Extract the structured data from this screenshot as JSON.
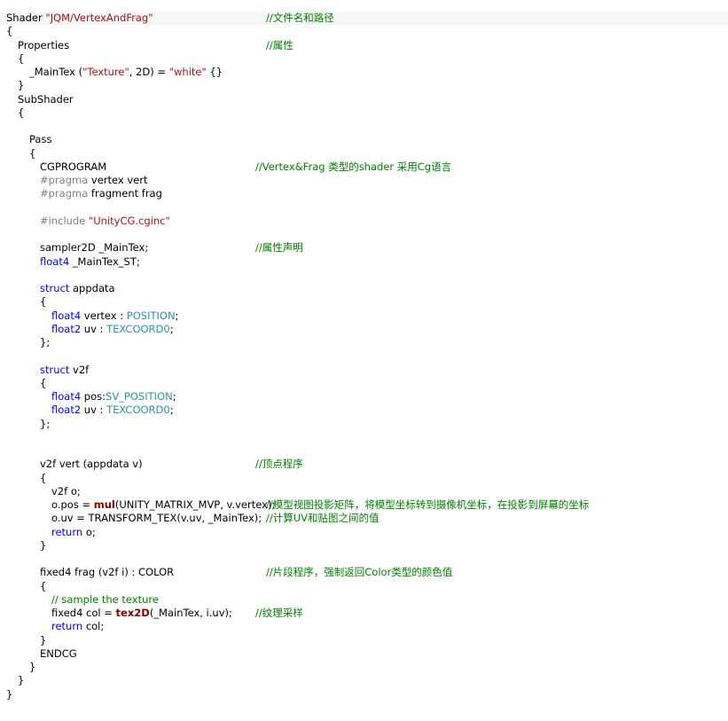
{
  "colors": {
    "plain": "#000000",
    "keyword": "#0000ff",
    "string": "#a31515",
    "comment": "#008000",
    "preprocessor": "#808080",
    "semantic": "#2b91af",
    "function": "#8b0000",
    "highlight_background": "#f6f6f6"
  },
  "code": [
    {
      "indent": 0,
      "highlight": true,
      "segments": [
        {
          "text": "Shader ",
          "type": "pl"
        },
        {
          "text": "\"JQM/VertexAndFrag\"",
          "type": "str"
        }
      ],
      "comment": "//文件名和路径",
      "comment_col": "c1"
    },
    {
      "indent": 0,
      "segments": [
        {
          "text": "{",
          "type": "pl"
        }
      ]
    },
    {
      "indent": 1,
      "segments": [
        {
          "text": "Properties",
          "type": "pl"
        }
      ],
      "comment": "//属性",
      "comment_col": "c1"
    },
    {
      "indent": 1,
      "segments": [
        {
          "text": "{",
          "type": "pl"
        }
      ]
    },
    {
      "indent": 2,
      "segments": [
        {
          "text": "_MainTex (",
          "type": "pl"
        },
        {
          "text": "\"Texture\"",
          "type": "str"
        },
        {
          "text": ", 2D) = ",
          "type": "pl"
        },
        {
          "text": "\"white\"",
          "type": "str"
        },
        {
          "text": " {}",
          "type": "pl"
        }
      ]
    },
    {
      "indent": 1,
      "segments": [
        {
          "text": "}",
          "type": "pl"
        }
      ]
    },
    {
      "indent": 1,
      "segments": [
        {
          "text": "SubShader",
          "type": "pl"
        }
      ]
    },
    {
      "indent": 1,
      "segments": [
        {
          "text": "{",
          "type": "pl"
        }
      ]
    },
    {
      "indent": 0,
      "segments": []
    },
    {
      "indent": 2,
      "segments": [
        {
          "text": "Pass",
          "type": "pl"
        }
      ]
    },
    {
      "indent": 2,
      "segments": [
        {
          "text": "{",
          "type": "pl"
        }
      ]
    },
    {
      "indent": 3,
      "segments": [
        {
          "text": "CGPROGRAM",
          "type": "pl"
        }
      ],
      "comment": "//Vertex&Frag 类型的shader 采用Cg语言",
      "comment_col": "c2"
    },
    {
      "indent": 3,
      "segments": [
        {
          "text": "#pragma",
          "type": "pp"
        },
        {
          "text": " vertex vert",
          "type": "pl"
        }
      ]
    },
    {
      "indent": 3,
      "segments": [
        {
          "text": "#pragma",
          "type": "pp"
        },
        {
          "text": " fragment frag",
          "type": "pl"
        }
      ]
    },
    {
      "indent": 0,
      "segments": []
    },
    {
      "indent": 3,
      "segments": [
        {
          "text": "#include ",
          "type": "pp"
        },
        {
          "text": "\"UnityCG.cginc\"",
          "type": "str"
        }
      ]
    },
    {
      "indent": 0,
      "segments": []
    },
    {
      "indent": 3,
      "segments": [
        {
          "text": "sampler2D _MainTex;",
          "type": "pl"
        }
      ],
      "comment": "//属性声明",
      "comment_col": "c2"
    },
    {
      "indent": 3,
      "segments": [
        {
          "text": "float4",
          "type": "kw"
        },
        {
          "text": " _MainTex_ST;",
          "type": "pl"
        }
      ]
    },
    {
      "indent": 0,
      "segments": []
    },
    {
      "indent": 3,
      "segments": [
        {
          "text": "struct",
          "type": "kw"
        },
        {
          "text": " appdata",
          "type": "pl"
        }
      ]
    },
    {
      "indent": 3,
      "segments": [
        {
          "text": "{",
          "type": "pl"
        }
      ]
    },
    {
      "indent": 4,
      "segments": [
        {
          "text": "float4",
          "type": "kw"
        },
        {
          "text": " vertex : ",
          "type": "pl"
        },
        {
          "text": "POSITION",
          "type": "sem"
        },
        {
          "text": ";",
          "type": "pl"
        }
      ]
    },
    {
      "indent": 4,
      "segments": [
        {
          "text": "float2",
          "type": "kw"
        },
        {
          "text": " uv : ",
          "type": "pl"
        },
        {
          "text": "TEXCOORD0",
          "type": "sem"
        },
        {
          "text": ";",
          "type": "pl"
        }
      ]
    },
    {
      "indent": 3,
      "segments": [
        {
          "text": "};",
          "type": "pl"
        }
      ]
    },
    {
      "indent": 0,
      "segments": []
    },
    {
      "indent": 3,
      "segments": [
        {
          "text": "struct",
          "type": "kw"
        },
        {
          "text": " v2f",
          "type": "pl"
        }
      ]
    },
    {
      "indent": 3,
      "segments": [
        {
          "text": "{",
          "type": "pl"
        }
      ]
    },
    {
      "indent": 4,
      "segments": [
        {
          "text": "float4",
          "type": "kw"
        },
        {
          "text": " pos:",
          "type": "pl"
        },
        {
          "text": "SV_POSITION",
          "type": "sem"
        },
        {
          "text": ";",
          "type": "pl"
        }
      ]
    },
    {
      "indent": 4,
      "segments": [
        {
          "text": "float2",
          "type": "kw"
        },
        {
          "text": " uv : ",
          "type": "pl"
        },
        {
          "text": "TEXCOORD0",
          "type": "sem"
        },
        {
          "text": ";",
          "type": "pl"
        }
      ]
    },
    {
      "indent": 3,
      "segments": [
        {
          "text": "};",
          "type": "pl"
        }
      ]
    },
    {
      "indent": 0,
      "segments": []
    },
    {
      "indent": 0,
      "segments": []
    },
    {
      "indent": 3,
      "segments": [
        {
          "text": "v2f vert (appdata v)",
          "type": "pl"
        }
      ],
      "comment": "//顶点程序",
      "comment_col": "c2"
    },
    {
      "indent": 3,
      "segments": [
        {
          "text": "{",
          "type": "pl"
        }
      ]
    },
    {
      "indent": 4,
      "segments": [
        {
          "text": "v2f o;",
          "type": "pl"
        }
      ]
    },
    {
      "indent": 4,
      "segments": [
        {
          "text": "o.pos = ",
          "type": "pl"
        },
        {
          "text": "mul",
          "type": "fn"
        },
        {
          "text": "(UNITY_MATRIX_MVP, v.vertex);",
          "type": "pl"
        }
      ],
      "comment": "//模型视图投影矩阵，将模型坐标转到摄像机坐标，在投影到屏幕的坐标",
      "comment_col": "c1"
    },
    {
      "indent": 4,
      "segments": [
        {
          "text": "o.uv = TRANSFORM_TEX(v.uv, _MainTex);",
          "type": "pl"
        }
      ],
      "comment": "//计算UV和贴图之间的值",
      "comment_col": "c1"
    },
    {
      "indent": 4,
      "segments": [
        {
          "text": "return",
          "type": "kw"
        },
        {
          "text": " o;",
          "type": "pl"
        }
      ]
    },
    {
      "indent": 3,
      "segments": [
        {
          "text": "}",
          "type": "pl"
        }
      ]
    },
    {
      "indent": 0,
      "segments": []
    },
    {
      "indent": 3,
      "segments": [
        {
          "text": "fixed4 frag (v2f i) : COLOR",
          "type": "pl"
        }
      ],
      "comment": "//片段程序，强制返回Color类型的颜色值",
      "comment_col": "c1"
    },
    {
      "indent": 3,
      "segments": [
        {
          "text": "{",
          "type": "pl"
        }
      ]
    },
    {
      "indent": 4,
      "segments": [
        {
          "text": "// sample the texture",
          "type": "cm"
        }
      ]
    },
    {
      "indent": 4,
      "segments": [
        {
          "text": "fixed4 col = ",
          "type": "pl"
        },
        {
          "text": "tex2D",
          "type": "fn"
        },
        {
          "text": "(_MainTex, i.uv);",
          "type": "pl"
        }
      ],
      "comment": "//纹理采样",
      "comment_col": "c2"
    },
    {
      "indent": 4,
      "segments": [
        {
          "text": "return",
          "type": "kw"
        },
        {
          "text": " col;",
          "type": "pl"
        }
      ]
    },
    {
      "indent": 3,
      "segments": [
        {
          "text": "}",
          "type": "pl"
        }
      ]
    },
    {
      "indent": 3,
      "segments": [
        {
          "text": "ENDCG",
          "type": "pl"
        }
      ]
    },
    {
      "indent": 2,
      "segments": [
        {
          "text": "}",
          "type": "pl"
        }
      ]
    },
    {
      "indent": 1,
      "segments": [
        {
          "text": "}",
          "type": "pl"
        }
      ]
    },
    {
      "indent": 0,
      "segments": [
        {
          "text": "}",
          "type": "pl"
        }
      ]
    }
  ]
}
